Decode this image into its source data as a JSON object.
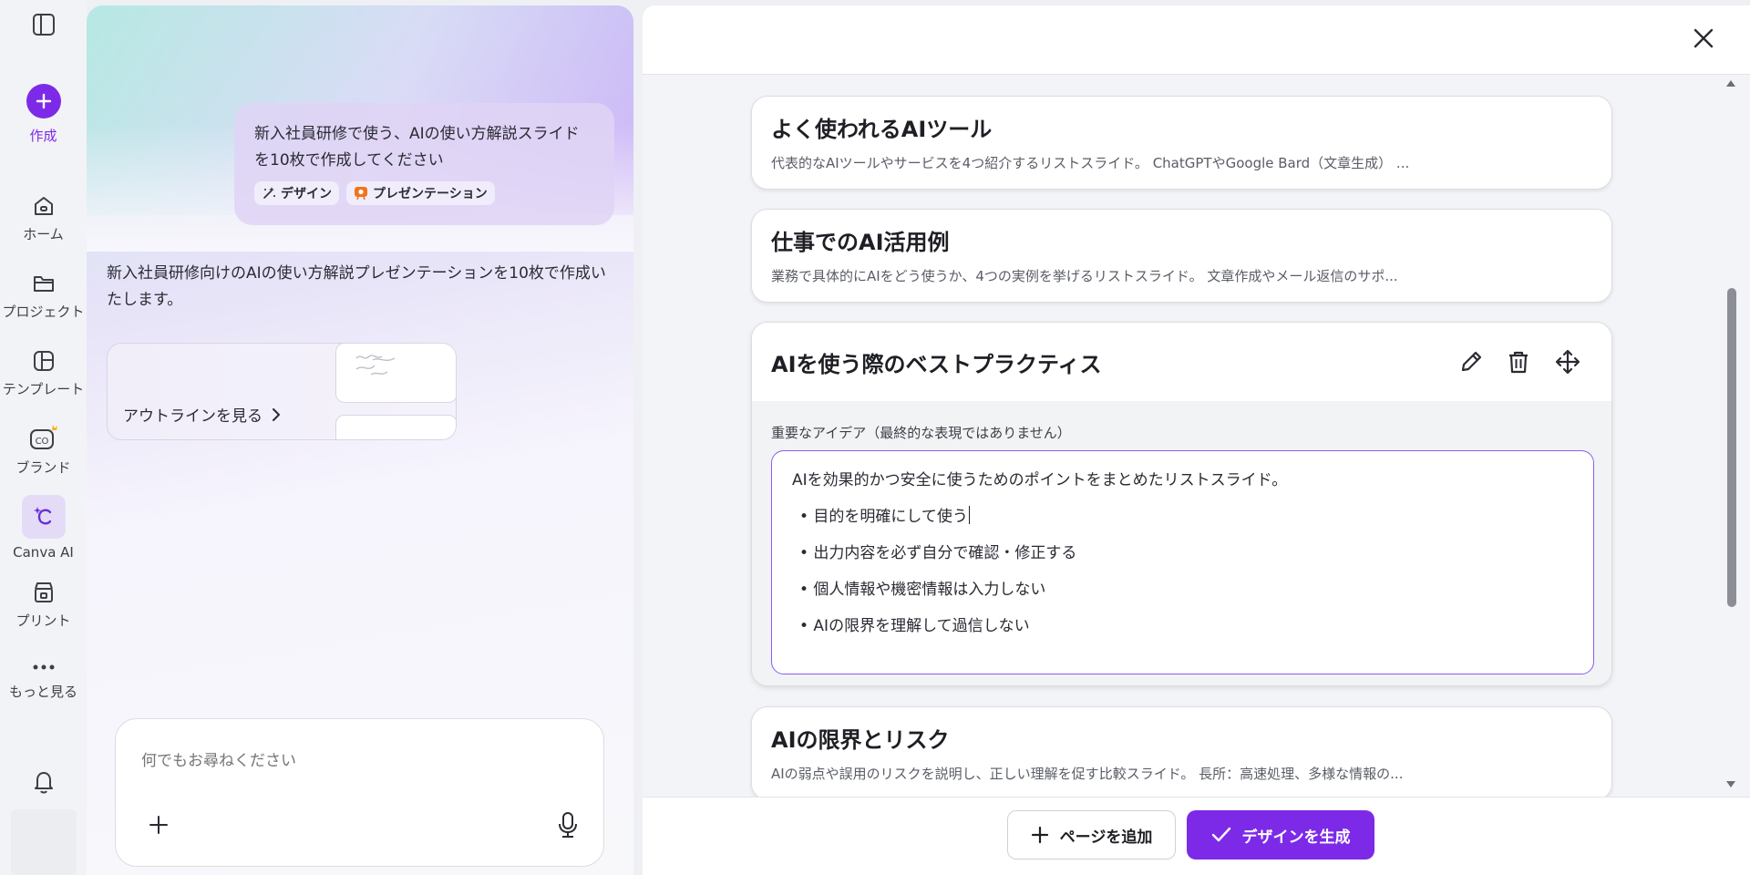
{
  "rail": {
    "items": [
      {
        "label": "作成",
        "icon": "plus-icon"
      },
      {
        "label": "ホーム",
        "icon": "home-icon"
      },
      {
        "label": "プロジェクト",
        "icon": "folder-icon"
      },
      {
        "label": "テンプレート",
        "icon": "template-icon"
      },
      {
        "label": "ブランド",
        "icon": "brand-icon"
      },
      {
        "label": "Canva AI",
        "icon": "canva-ai-icon"
      },
      {
        "label": "プリント",
        "icon": "print-icon"
      },
      {
        "label": "もっと見る",
        "icon": "more-icon"
      }
    ],
    "accent": "#7d2ae8"
  },
  "chat": {
    "user_message": "新入社員研修で使う、AIの使い方解説スライドを10枚で作成してください",
    "tags": [
      "デザイン",
      "プレゼンテーション"
    ],
    "ai_reply": "新入社員研修向けのAIの使い方解説プレゼンテーションを10枚で作成いたします。",
    "outline_link": "アウトラインを見る",
    "input_placeholder": "何でもお尋ねください"
  },
  "editor": {
    "slides": [
      {
        "title": "よく使われるAIツール",
        "desc": "代表的なAIツールやサービスを4つ紹介するリストスライド。 ChatGPTやGoogle Bard（文章生成） ..."
      },
      {
        "title": "仕事でのAI活用例",
        "desc": "業務で具体的にAIをどう使うか、4つの実例を挙げるリストスライド。 文章作成やメール返信のサポ..."
      },
      {
        "title": "AIの限界とリスク",
        "desc": "AIの弱点や誤用のリスクを説明し、正しい理解を促す比較スライド。 長所：高速処理、多様な情報の..."
      }
    ],
    "expanded": {
      "title": "AIを使う際のベストプラクティス",
      "idea_label": "重要なアイデア（最終的な表現ではありません）",
      "intro": "AIを効果的かつ安全に使うためのポイントをまとめたリストスライド。",
      "bullets": [
        "• 目的を明確にして使う",
        "• 出力内容を必ず自分で確認・修正する",
        "• 個人情報や機密情報は入力しない",
        "• AIの限界を理解して過信しない"
      ]
    },
    "add_page_label": "ページを追加",
    "generate_label": "デザインを生成"
  }
}
